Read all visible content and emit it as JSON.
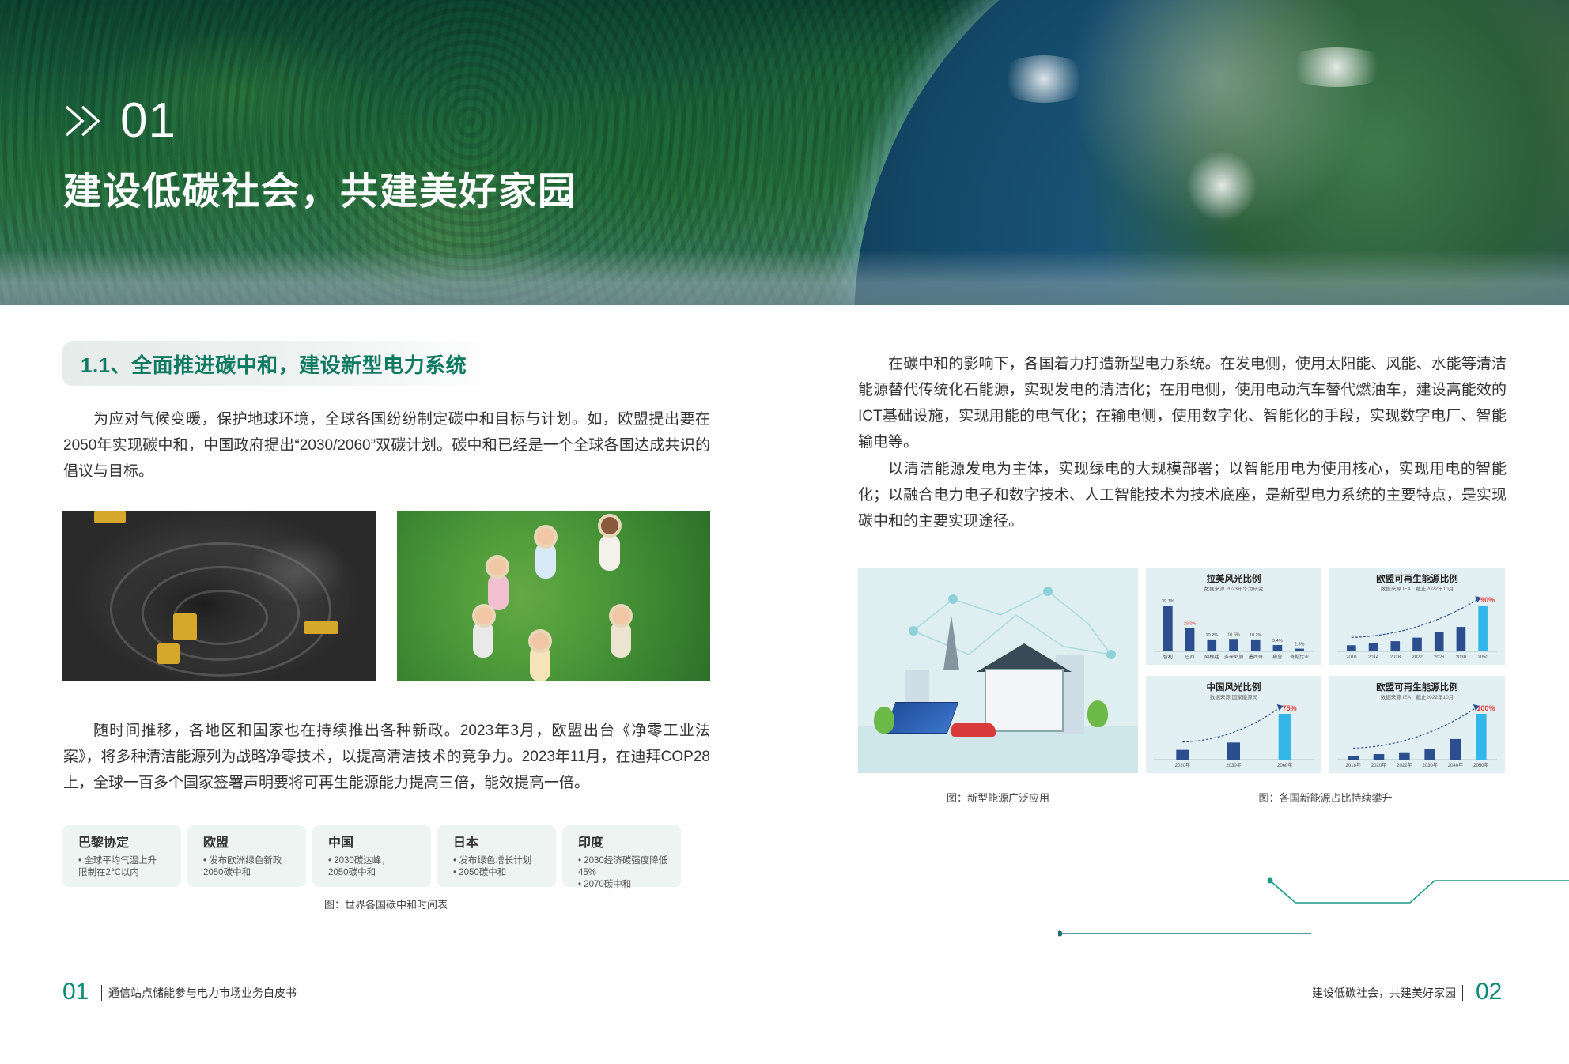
{
  "banner": {
    "section_number": "01",
    "title": "建设低碳社会，共建美好家园"
  },
  "left": {
    "subheading": "1.1、全面推进碳中和，建设新型电力系统",
    "paragraph1": "为应对气候变暖，保护地球环境，全球各国纷纷制定碳中和目标与计划。如，欧盟提出要在2050年实现碳中和，中国政府提出“2030/2060”双碳计划。碳中和已经是一个全球各国达成共识的倡议与目标。",
    "paragraph2": "随时间推移，各地区和国家也在持续推出各种新政。2023年3月，欧盟出台《净零工业法案》，将多种清洁能源列为战略净零技术，以提高清洁技术的竞争力。2023年11月，在迪拜COP28上，全球一百多个国家签署声明要将可再生能源能力提高三倍，能效提高一倍。",
    "cards": [
      {
        "title": "巴黎协定",
        "lines": [
          "• 全球平均气温上升",
          "  限制在2℃以内"
        ]
      },
      {
        "title": "欧盟",
        "lines": [
          "• 发布欧洲绿色新政",
          "  2050碳中和"
        ]
      },
      {
        "title": "中国",
        "lines": [
          "• 2030碳达峰，",
          "  2050碳中和"
        ]
      },
      {
        "title": "日本",
        "lines": [
          "• 发布绿色增长计划",
          "• 2050碳中和"
        ]
      },
      {
        "title": "印度",
        "lines": [
          "• 2030经济碳强度降低45%",
          "• 2070碳中和"
        ]
      }
    ],
    "cards_caption": "图：世界各国碳中和时间表"
  },
  "right": {
    "paragraph3": "在碳中和的影响下，各国着力打造新型电力系统。在发电侧，使用太阳能、风能、水能等清洁能源替代传统化石能源，实现发电的清洁化；在用电侧，使用电动汽车替代燃油车，建设高能效的ICT基础设施，实现用能的电气化；在输电侧，使用数字化、智能化的手段，实现数字电厂、智能输电等。",
    "paragraph4": "以清洁能源发电为主体，实现绿电的大规模部署；以智能用电为使用核心，实现用电的智能化；以融合电力电子和数字技术、人工智能技术为技术底座，是新型电力系统的主要特点，是实现碳中和的主要实现途径。",
    "illus_caption": "图：新型能源广泛应用",
    "charts_caption": "图：各国新能源占比持续攀升"
  },
  "chart_data": [
    {
      "type": "bar",
      "title": "拉美风光比例",
      "subtitle": "数据来源 2023年华为研究",
      "categories": [
        "智利",
        "巴西",
        "阿根廷",
        "多米尼加",
        "墨西哥",
        "秘鲁",
        "哥伦比亚"
      ],
      "values": [
        39.1,
        20.0,
        10.2,
        10.6,
        10.2,
        5.4,
        2.3
      ],
      "data_labels": [
        "39.1%",
        "20.0%",
        "10.2%",
        "10.6%",
        "10.2%",
        "5.4%",
        "2.3%"
      ],
      "highlight_index": 1,
      "colors": {
        "bar": "#2b4f8e",
        "highlight_label": "#e53935"
      }
    },
    {
      "type": "bar",
      "title": "欧盟可再生能源比例",
      "subtitle": "数据来源 IEA，截止2022年10月",
      "categories": [
        "2010",
        "2014",
        "2018",
        "2022",
        "2026",
        "2030",
        "2050"
      ],
      "values": [
        12,
        16,
        20,
        27,
        38,
        48,
        90
      ],
      "data_labels": [
        "",
        "",
        "",
        "",
        "",
        "",
        "90%"
      ],
      "highlight_index": 6,
      "colors": {
        "bar": "#2b4f8e",
        "highlight": "#34b6e8",
        "highlight_label": "#e53935"
      }
    },
    {
      "type": "bar",
      "title": "中国风光比例",
      "subtitle": "数据来源 国家能源局",
      "categories": [
        "2020年",
        "2030年",
        "2060年"
      ],
      "values": [
        16,
        28,
        75
      ],
      "data_labels": [
        "",
        "",
        "75%"
      ],
      "highlight_index": 2,
      "colors": {
        "bar": "#2b4f8e",
        "highlight": "#34b6e8",
        "highlight_label": "#e53935"
      }
    },
    {
      "type": "bar",
      "title": "欧盟可再生能源比例",
      "subtitle": "数据来源 IEA，截止2022年10月",
      "categories": [
        "2018年",
        "2020年",
        "2022年",
        "2030年",
        "2040年",
        "2050年"
      ],
      "values": [
        8,
        12,
        16,
        24,
        45,
        100
      ],
      "data_labels": [
        "",
        "",
        "",
        "",
        "",
        "100%"
      ],
      "highlight_index": 5,
      "colors": {
        "bar": "#2b4f8e",
        "highlight": "#34b6e8",
        "highlight_label": "#e53935"
      }
    }
  ],
  "footer": {
    "left_page_number": "01",
    "left_title": "通信站点储能参与电力市场业务白皮书",
    "right_title": "建设低碳社会，共建美好家园",
    "right_page_number": "02"
  },
  "colors": {
    "accent": "#0d7a61",
    "chart_bar": "#2b4f8e",
    "chart_highlight": "#34b6e8",
    "label_red": "#e53935"
  }
}
